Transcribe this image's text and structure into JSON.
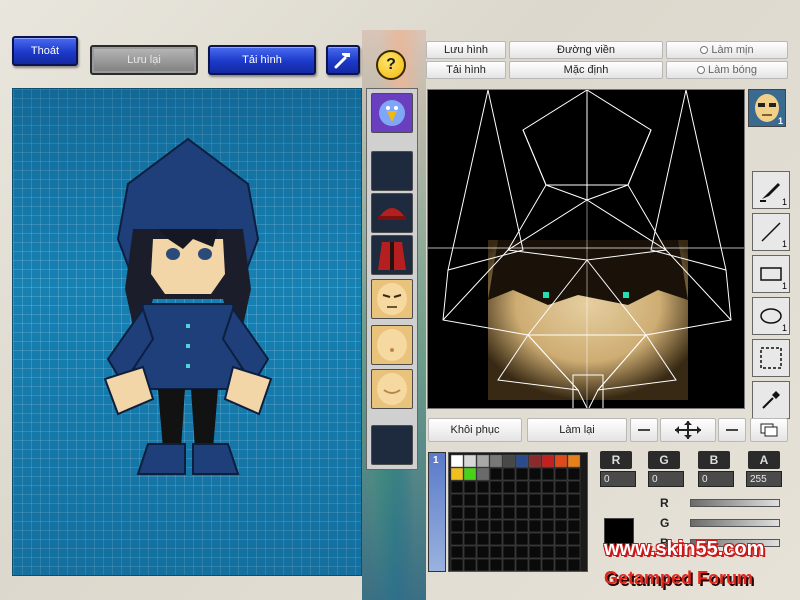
{
  "top_buttons": {
    "exit": "Thoát",
    "save": "Lưu lại",
    "load": "Tải hình"
  },
  "editor_toolbar": {
    "save_image": "Lưu hình",
    "load_image": "Tải hình",
    "outline": "Đường viền",
    "default": "Mặc định",
    "smooth": "Làm mịn",
    "shine": "Làm bóng"
  },
  "bottom_buttons": {
    "restore": "Khôi phục",
    "redo": "Làm lại"
  },
  "tools": [
    {
      "icon": "pen-icon",
      "count": "1"
    },
    {
      "icon": "line-icon",
      "count": "1"
    },
    {
      "icon": "rectangle-icon",
      "count": "1"
    },
    {
      "icon": "ellipse-icon",
      "count": "1"
    },
    {
      "icon": "selection-icon",
      "count": ""
    },
    {
      "icon": "eyedropper-icon",
      "count": ""
    }
  ],
  "face_thumb_count": "1",
  "color": {
    "labels": [
      "R",
      "G",
      "B",
      "A"
    ],
    "values": [
      "0",
      "0",
      "0",
      "255"
    ]
  },
  "sliders": [
    "R",
    "G",
    "B"
  ],
  "layer_indicator": "1",
  "watermark": {
    "site": "www.skin55.com",
    "forum": "Getamped Forum"
  },
  "colors": {
    "accent_blue": "#1c39c9",
    "canvas_blue": "#1681b3",
    "watermark_red": "#e0281c"
  }
}
